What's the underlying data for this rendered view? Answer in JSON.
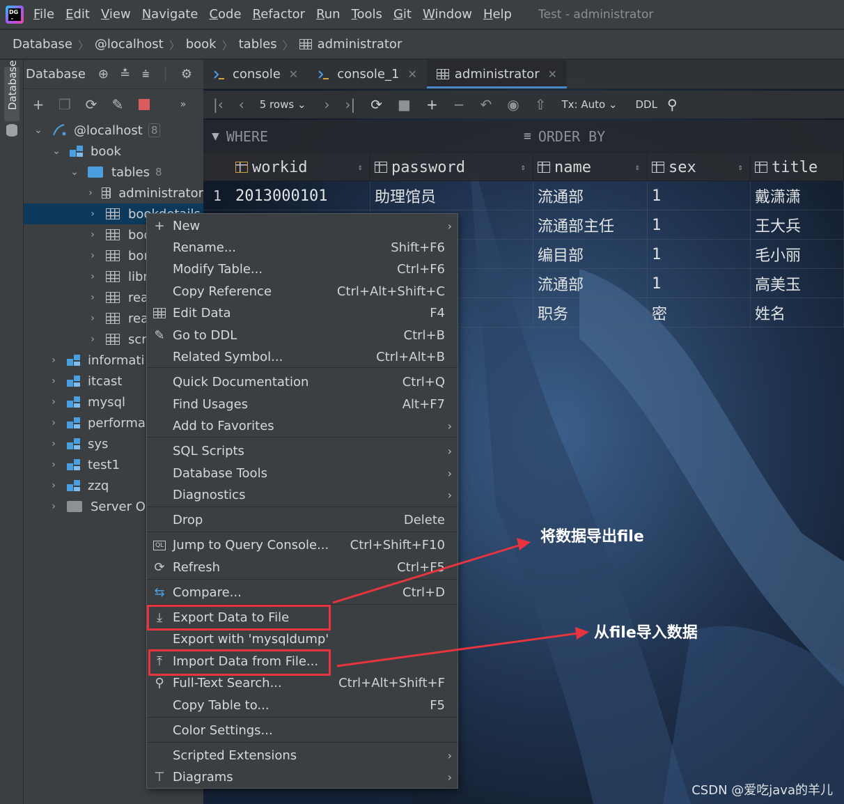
{
  "menubar": {
    "items": [
      "File",
      "Edit",
      "View",
      "Navigate",
      "Code",
      "Refactor",
      "Run",
      "Tools",
      "Git",
      "Window",
      "Help"
    ],
    "window_title": "Test - administrator"
  },
  "breadcrumb": [
    "Database",
    "@localhost",
    "book",
    "tables",
    "administrator"
  ],
  "tool_strip": {
    "label": "Database"
  },
  "db_panel": {
    "title": "Database",
    "tree": [
      {
        "label": "@localhost",
        "count": "8"
      },
      {
        "label": "book"
      },
      {
        "label": "tables",
        "count": "8"
      },
      {
        "label": "administrator"
      },
      {
        "label": "bookdetails"
      },
      {
        "label": "boo"
      },
      {
        "label": "bor"
      },
      {
        "label": "libr"
      },
      {
        "label": "rea"
      },
      {
        "label": "rea"
      },
      {
        "label": "scri"
      },
      {
        "label": "informati"
      },
      {
        "label": "itcast"
      },
      {
        "label": "mysql"
      },
      {
        "label": "performa"
      },
      {
        "label": "sys"
      },
      {
        "label": "test1"
      },
      {
        "label": "zzq"
      },
      {
        "label": "Server Ob"
      }
    ]
  },
  "tabs": [
    {
      "label": "console"
    },
    {
      "label": "console_1"
    },
    {
      "label": "administrator"
    }
  ],
  "grid_toolbar": {
    "rows": "5 rows",
    "tx": "Tx: Auto",
    "ddl": "DDL"
  },
  "filter": {
    "where": "WHERE",
    "order_by": "ORDER BY"
  },
  "grid": {
    "columns": [
      "workid",
      "password",
      "name",
      "sex",
      "title"
    ],
    "rows": [
      {
        "num": "1",
        "workid": "2013000101",
        "password": "助理馆员",
        "name": "流通部",
        "sex": "1",
        "title": "戴潇潇"
      },
      {
        "num": "",
        "workid": "",
        "password": "",
        "name": "流通部主任",
        "sex": "1",
        "title": "王大兵"
      },
      {
        "num": "",
        "workid": "",
        "password": "",
        "name": "编目部",
        "sex": "1",
        "title": "毛小丽"
      },
      {
        "num": "",
        "workid": "",
        "password": "",
        "name": "流通部",
        "sex": "1",
        "title": "高美玉"
      },
      {
        "num": "",
        "workid": "",
        "password": "",
        "name": "职务",
        "sex": "密",
        "title": "姓名"
      }
    ]
  },
  "context_menu": {
    "items": [
      {
        "label": "New",
        "shortcut": "",
        "submenu": true,
        "icon": "plus-icon"
      },
      {
        "label": "Rename...",
        "shortcut": "Shift+F6"
      },
      {
        "label": "Modify Table...",
        "shortcut": "Ctrl+F6"
      },
      {
        "label": "Copy Reference",
        "shortcut": "Ctrl+Alt+Shift+C"
      },
      {
        "label": "Edit Data",
        "shortcut": "F4",
        "icon": "table-icon"
      },
      {
        "label": "Go to DDL",
        "shortcut": "Ctrl+B",
        "icon": "pencil-icon"
      },
      {
        "label": "Related Symbol...",
        "shortcut": "Ctrl+Alt+B"
      },
      {
        "label": "Quick Documentation",
        "shortcut": "Ctrl+Q"
      },
      {
        "label": "Find Usages",
        "shortcut": "Alt+F7"
      },
      {
        "label": "Add to Favorites",
        "shortcut": "",
        "submenu": true
      },
      {
        "label": "SQL Scripts",
        "shortcut": "",
        "submenu": true
      },
      {
        "label": "Database Tools",
        "shortcut": "",
        "submenu": true
      },
      {
        "label": "Diagnostics",
        "shortcut": "",
        "submenu": true
      },
      {
        "label": "Drop",
        "shortcut": "Delete"
      },
      {
        "label": "Jump to Query Console...",
        "shortcut": "Ctrl+Shift+F10",
        "icon": "ql-icon"
      },
      {
        "label": "Refresh",
        "shortcut": "Ctrl+F5",
        "icon": "refresh-icon"
      },
      {
        "label": "Compare...",
        "shortcut": "Ctrl+D",
        "icon": "compare-icon"
      },
      {
        "label": "Export Data to File",
        "shortcut": "",
        "icon": "export-icon"
      },
      {
        "label": "Export with 'mysqldump'",
        "shortcut": ""
      },
      {
        "label": "Import Data from File...",
        "shortcut": "",
        "icon": "import-icon"
      },
      {
        "label": "Full-Text Search...",
        "shortcut": "Ctrl+Alt+Shift+F",
        "icon": "search-icon"
      },
      {
        "label": "Copy Table to...",
        "shortcut": "F5"
      },
      {
        "label": "Color Settings...",
        "shortcut": ""
      },
      {
        "label": "Scripted Extensions",
        "shortcut": "",
        "submenu": true
      },
      {
        "label": "Diagrams",
        "shortcut": "",
        "submenu": true,
        "icon": "diagram-icon"
      }
    ]
  },
  "annotations": {
    "export": "将数据导出file",
    "import": "从file导入数据",
    "color": "#e8343e"
  },
  "watermark": "CSDN @爱吃java的羊儿"
}
